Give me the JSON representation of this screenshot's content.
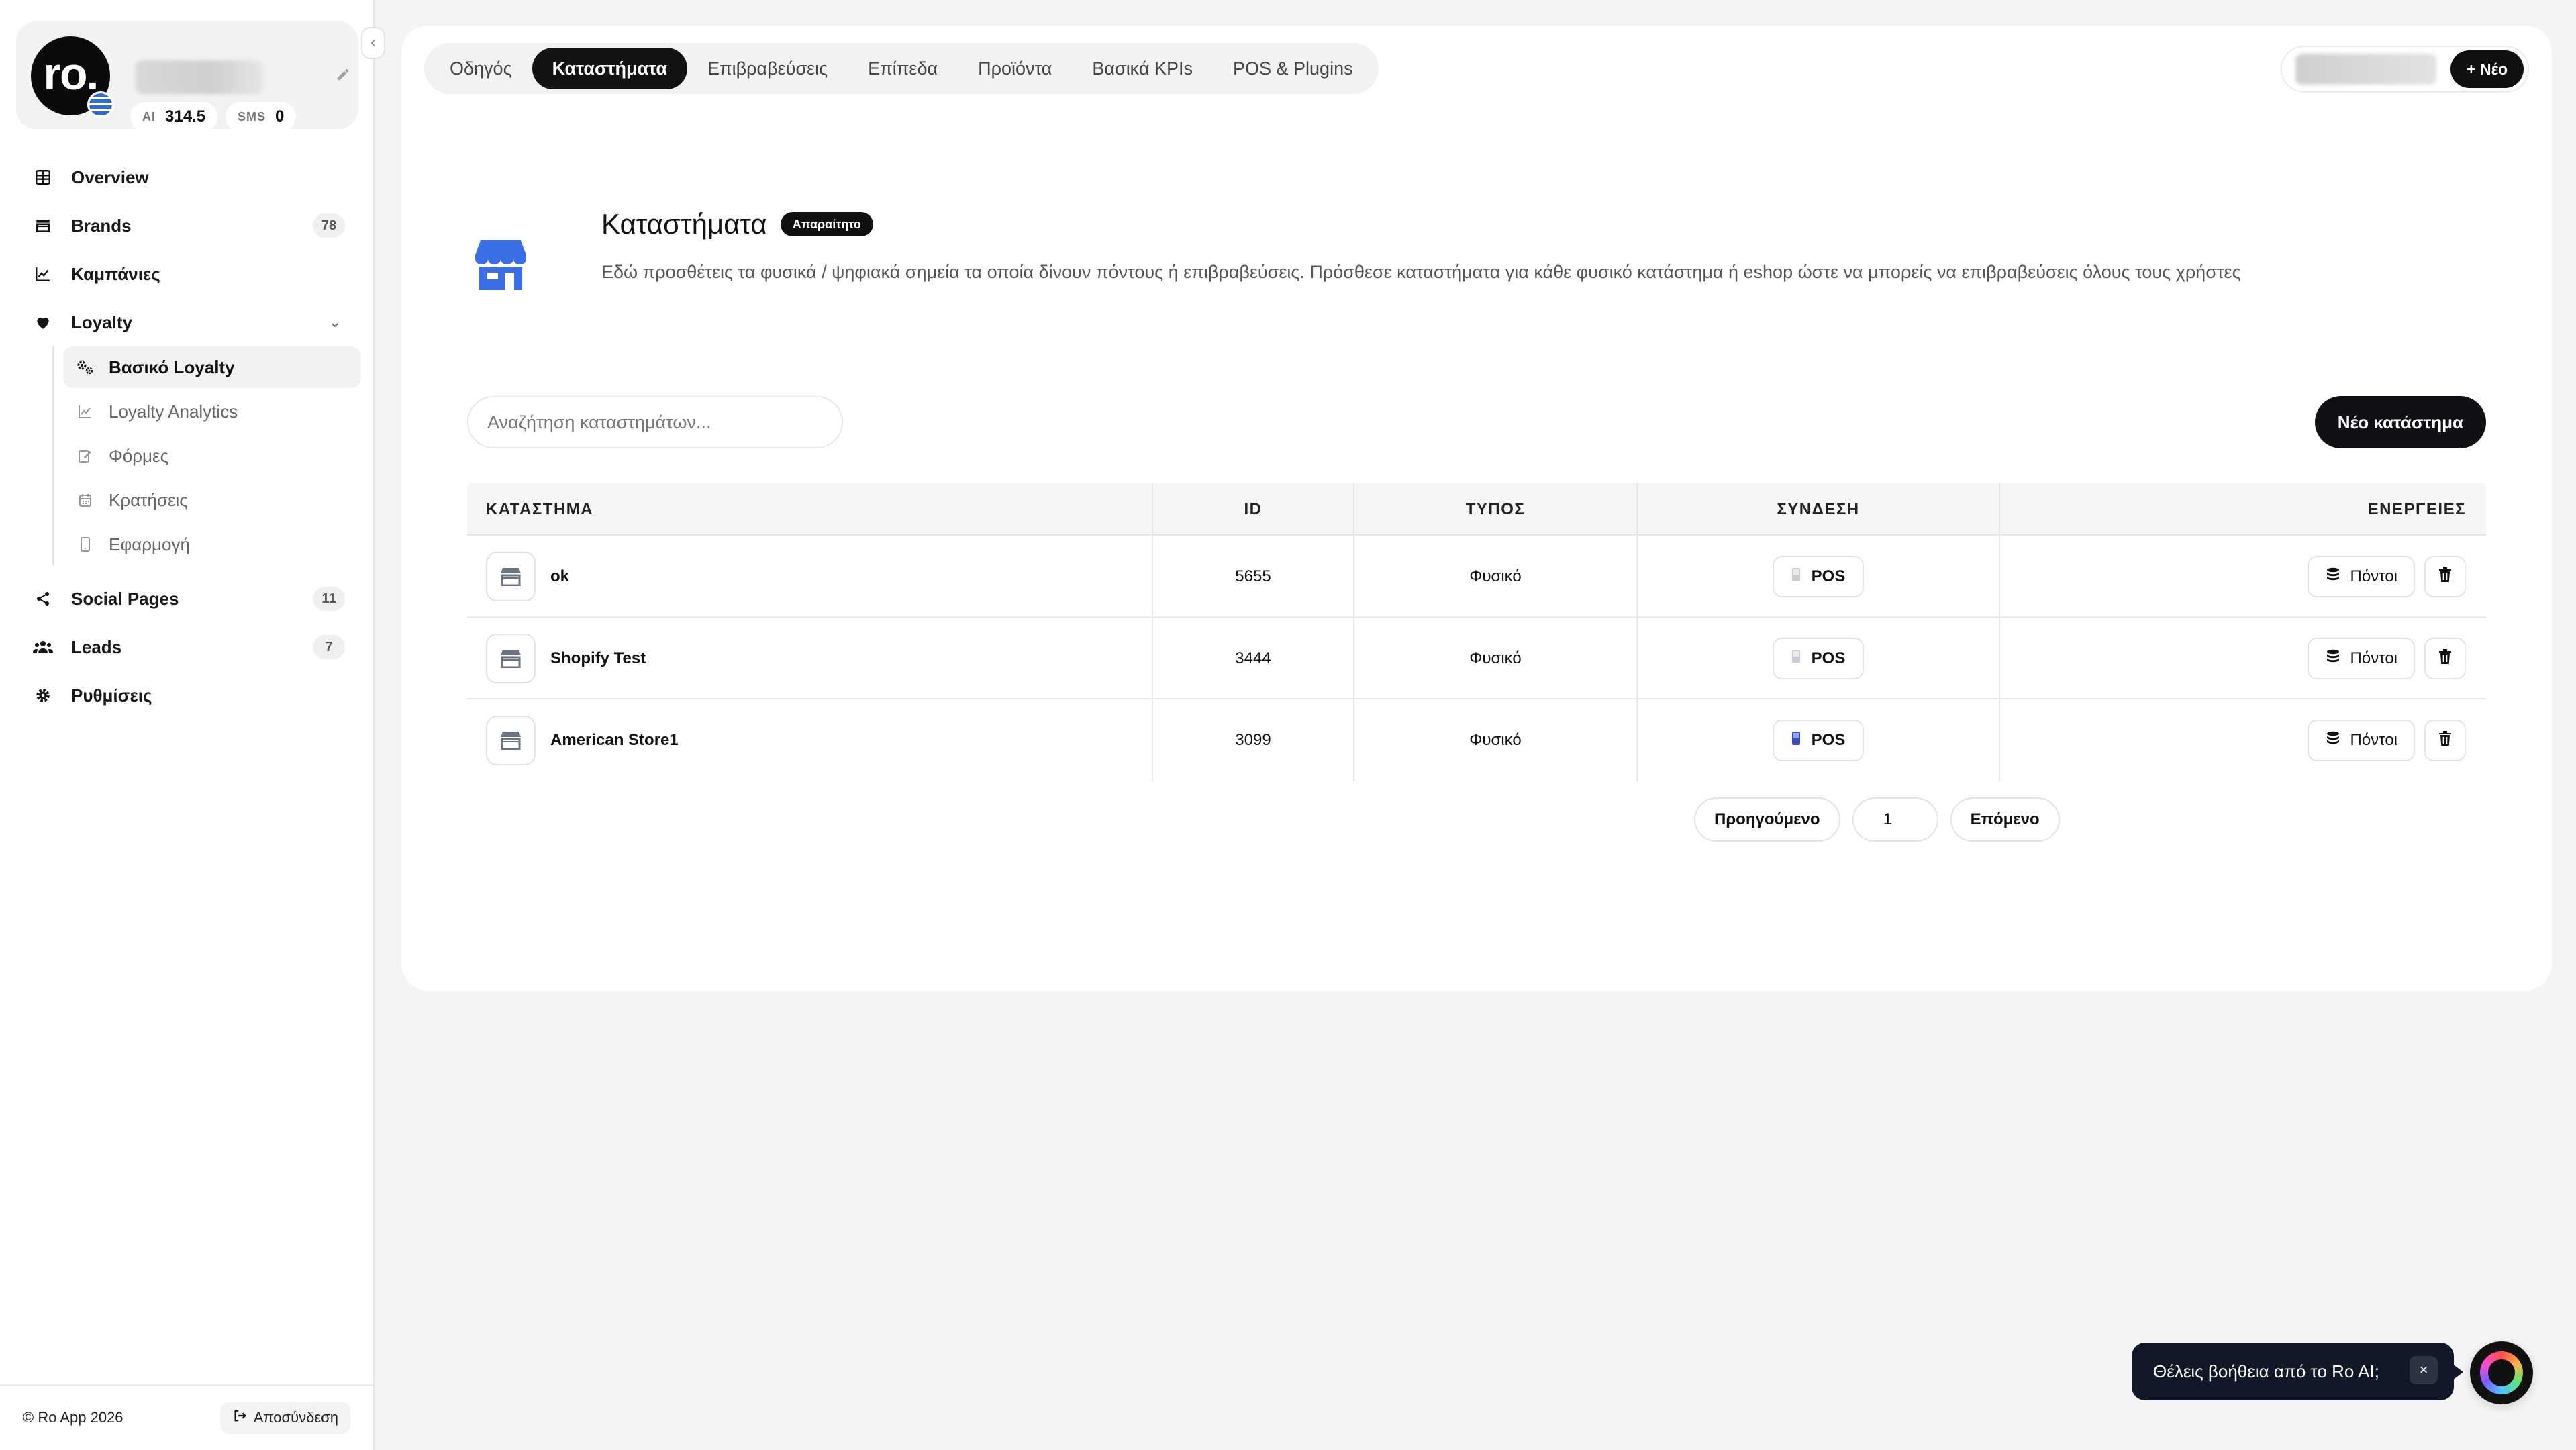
{
  "colors": {
    "accent": "#101010",
    "store_icon": "#3b6fe6",
    "ai_bubble": "#111827"
  },
  "profile": {
    "avatar_text": "ro.",
    "ai_label": "AI",
    "ai_value": "314.5",
    "sms_label": "SMS",
    "sms_value": "0"
  },
  "sidebar": {
    "items": [
      {
        "label": "Overview",
        "icon": "grid-icon"
      },
      {
        "label": "Brands",
        "icon": "store-icon",
        "badge": "78"
      },
      {
        "label": "Καμπάνιες",
        "icon": "chart-line-icon"
      },
      {
        "label": "Loyalty",
        "icon": "heart-icon"
      }
    ],
    "loyalty_sub": [
      {
        "label": "Βασικό Loyalty",
        "icon": "gears-icon"
      },
      {
        "label": "Loyalty Analytics",
        "icon": "chart-icon"
      },
      {
        "label": "Φόρμες",
        "icon": "edit-icon"
      },
      {
        "label": "Κρατήσεις",
        "icon": "calendar-icon"
      },
      {
        "label": "Εφαρμογή",
        "icon": "phone-icon"
      }
    ],
    "items_after": [
      {
        "label": "Social Pages",
        "icon": "share-icon",
        "badge": "11"
      },
      {
        "label": "Leads",
        "icon": "users-icon",
        "badge": "7"
      },
      {
        "label": "Ρυθμίσεις",
        "icon": "gear-icon"
      }
    ],
    "footer": {
      "copyright": "© Ro App  2026",
      "logout": "Αποσύνδεση"
    }
  },
  "tabs": [
    "Οδηγός",
    "Καταστήματα",
    "Επιβραβεύσεις",
    "Επίπεδα",
    "Προϊόντα",
    "Βασικά KPIs",
    "POS & Plugins"
  ],
  "top_right": {
    "new_label": "+ Νέο"
  },
  "page": {
    "title": "Καταστήματα",
    "required_badge": "Απαραίτητο",
    "description": "Εδώ προσθέτεις τα φυσικά / ψηφιακά σημεία τα οποία δίνουν πόντους ή επιβραβεύσεις. Πρόσθεσε καταστήματα για κάθε φυσικό κατάστημα ή eshop ώστε να μπορείς να επιβραβεύσεις όλους τους χρήστες"
  },
  "search": {
    "placeholder": "Αναζήτηση καταστημάτων..."
  },
  "new_store_button": "Νέο κατάστημα",
  "table": {
    "headers": [
      "ΚΑΤΑΣΤΗΜΑ",
      "ID",
      "ΤΥΠΟΣ",
      "ΣΥΝΔΕΣΗ",
      "ΕΝΕΡΓΕΙΕΣ"
    ],
    "rows": [
      {
        "name": "ok",
        "id": "5655",
        "type": "Φυσικό",
        "connection": "POS",
        "points": "Πόντοι"
      },
      {
        "name": "Shopify Test",
        "id": "3444",
        "type": "Φυσικό",
        "connection": "POS",
        "points": "Πόντοι"
      },
      {
        "name": "American Store1",
        "id": "3099",
        "type": "Φυσικό",
        "connection": "POS",
        "points": "Πόντοι"
      }
    ]
  },
  "pagination": {
    "prev": "Προηγούμενο",
    "page": "1",
    "next": "Επόμενο"
  },
  "ai_help": {
    "text": "Θέλεις βοήθεια από το Ro AI;",
    "close": "×"
  }
}
